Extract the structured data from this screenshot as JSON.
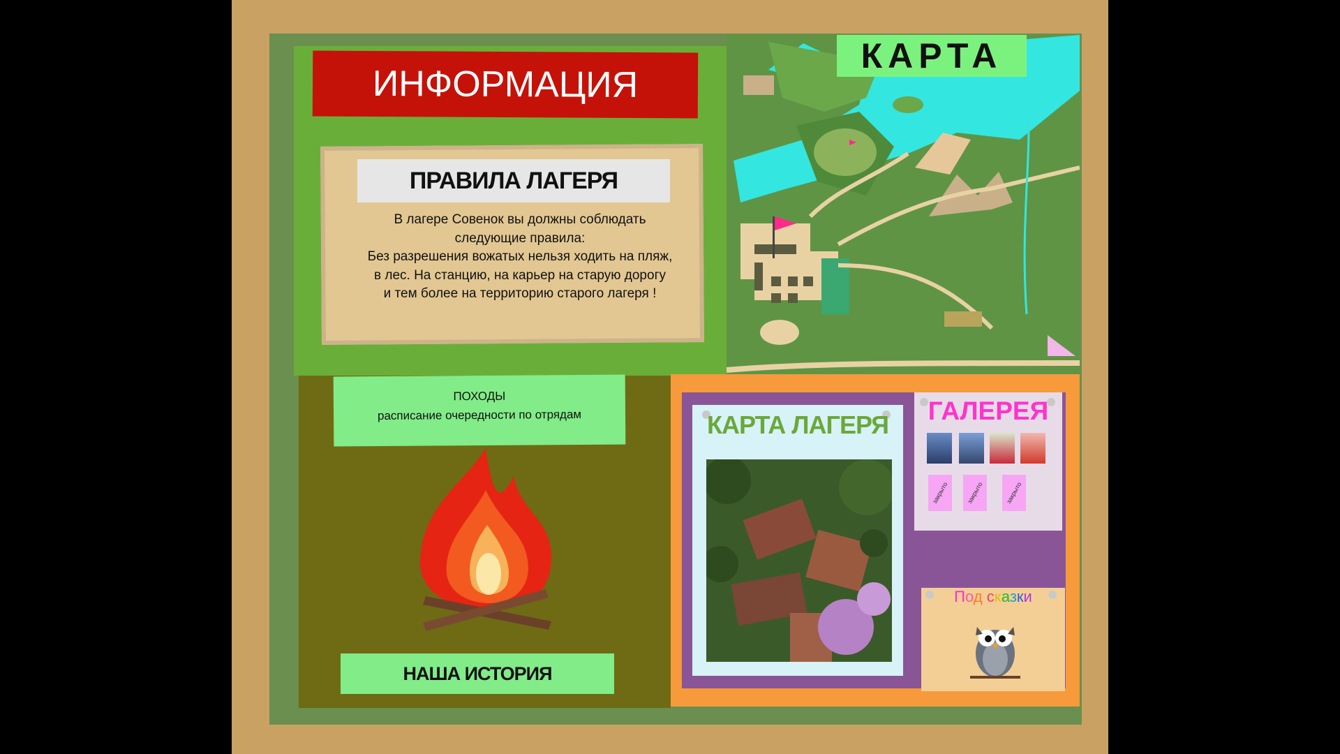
{
  "info": {
    "title": "ИНФОРМАЦИЯ"
  },
  "rules": {
    "title": "ПРАВИЛА ЛАГЕРЯ",
    "lines": [
      "В лагере Совенок вы должны соблюдать",
      "следующие правила:",
      "Без разрешения вожатых нельзя ходить на пляж,",
      "в лес. На станцию, на карьер на старую дорогу",
      "и тем более на территорию старого лагеря !"
    ]
  },
  "map": {
    "title": "КАРТА"
  },
  "hikes": {
    "title": "ПОХОДЫ",
    "subtitle": "расписание очередности по отрядам"
  },
  "history": {
    "label": "НАША ИСТОРИЯ"
  },
  "camp_map": {
    "title": "КАРТА ЛАГЕРЯ"
  },
  "gallery": {
    "title": "ГАЛЕРЕЯ",
    "locked": [
      "закрыто",
      "закрыто",
      "закрыто"
    ]
  },
  "fairy_tales": {
    "letters": [
      "П",
      "о",
      "д",
      " ",
      "с",
      "к",
      "а",
      "з",
      "к",
      "и"
    ]
  },
  "colors": {
    "board": "#c9a163",
    "frame": "#6a8f4f",
    "info_panel": "#6aae3a",
    "banner_red": "#c51208",
    "map_green": "#5f9445",
    "water": "#33e6e0",
    "hike_olive": "#6e6b14",
    "mint": "#82ec88",
    "orange": "#f69a3c",
    "purple": "#8a5596",
    "gallery_pink": "#ff33cc"
  },
  "icons": [
    "campfire-icon",
    "owl-icon",
    "flag-icon"
  ]
}
